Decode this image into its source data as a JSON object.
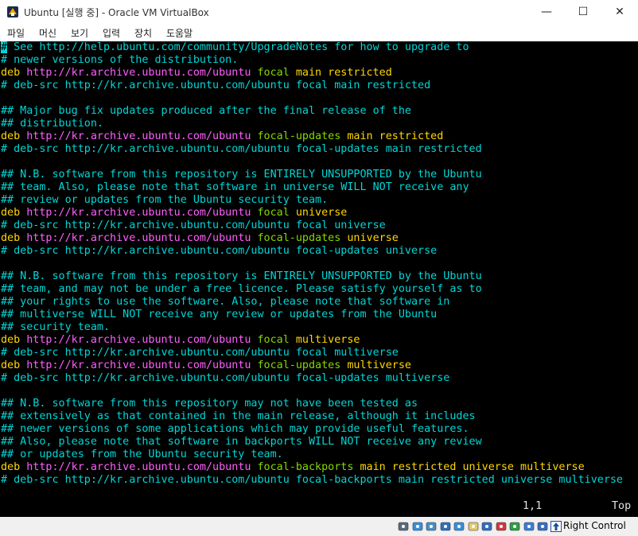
{
  "window": {
    "title": "Ubuntu [실행 중] - Oracle VM VirtualBox",
    "controls": {
      "minimize": "—",
      "maximize": "☐",
      "close": "✕"
    }
  },
  "menu": [
    "파일",
    "머신",
    "보기",
    "입력",
    "장치",
    "도움말"
  ],
  "terminal": {
    "lines": [
      [
        {
          "t": "#",
          "c": "cyan cursor"
        },
        {
          "t": " See http://help.ubuntu.com/community/UpgradeNotes for how to upgrade to",
          "c": "cyan"
        }
      ],
      [
        {
          "t": "# newer versions of the distribution.",
          "c": "cyan"
        }
      ],
      [
        {
          "t": "deb ",
          "c": "yellow"
        },
        {
          "t": "http://kr.archive.ubuntu.com/ubuntu ",
          "c": "magenta"
        },
        {
          "t": "focal ",
          "c": "green"
        },
        {
          "t": "main restricted",
          "c": "yellow"
        }
      ],
      [
        {
          "t": "# deb-src http://kr.archive.ubuntu.com/ubuntu focal main restricted",
          "c": "cyan"
        }
      ],
      [],
      [
        {
          "t": "## Major bug fix updates produced after the final release of the",
          "c": "cyan"
        }
      ],
      [
        {
          "t": "## distribution.",
          "c": "cyan"
        }
      ],
      [
        {
          "t": "deb ",
          "c": "yellow"
        },
        {
          "t": "http://kr.archive.ubuntu.com/ubuntu ",
          "c": "magenta"
        },
        {
          "t": "focal-updates ",
          "c": "green"
        },
        {
          "t": "main restricted",
          "c": "yellow"
        }
      ],
      [
        {
          "t": "# deb-src http://kr.archive.ubuntu.com/ubuntu focal-updates main restricted",
          "c": "cyan"
        }
      ],
      [],
      [
        {
          "t": "## N.B. software from this repository is ENTIRELY UNSUPPORTED by the Ubuntu",
          "c": "cyan"
        }
      ],
      [
        {
          "t": "## team. Also, please note that software in universe WILL NOT receive any",
          "c": "cyan"
        }
      ],
      [
        {
          "t": "## review or updates from the Ubuntu security team.",
          "c": "cyan"
        }
      ],
      [
        {
          "t": "deb ",
          "c": "yellow"
        },
        {
          "t": "http://kr.archive.ubuntu.com/ubuntu ",
          "c": "magenta"
        },
        {
          "t": "focal ",
          "c": "green"
        },
        {
          "t": "universe",
          "c": "yellow"
        }
      ],
      [
        {
          "t": "# deb-src http://kr.archive.ubuntu.com/ubuntu focal universe",
          "c": "cyan"
        }
      ],
      [
        {
          "t": "deb ",
          "c": "yellow"
        },
        {
          "t": "http://kr.archive.ubuntu.com/ubuntu ",
          "c": "magenta"
        },
        {
          "t": "focal-updates ",
          "c": "green"
        },
        {
          "t": "universe",
          "c": "yellow"
        }
      ],
      [
        {
          "t": "# deb-src http://kr.archive.ubuntu.com/ubuntu focal-updates universe",
          "c": "cyan"
        }
      ],
      [],
      [
        {
          "t": "## N.B. software from this repository is ENTIRELY UNSUPPORTED by the Ubuntu",
          "c": "cyan"
        }
      ],
      [
        {
          "t": "## team, and may not be under a free licence. Please satisfy yourself as to",
          "c": "cyan"
        }
      ],
      [
        {
          "t": "## your rights to use the software. Also, please note that software in",
          "c": "cyan"
        }
      ],
      [
        {
          "t": "## multiverse WILL NOT receive any review or updates from the Ubuntu",
          "c": "cyan"
        }
      ],
      [
        {
          "t": "## security team.",
          "c": "cyan"
        }
      ],
      [
        {
          "t": "deb ",
          "c": "yellow"
        },
        {
          "t": "http://kr.archive.ubuntu.com/ubuntu ",
          "c": "magenta"
        },
        {
          "t": "focal ",
          "c": "green"
        },
        {
          "t": "multiverse",
          "c": "yellow"
        }
      ],
      [
        {
          "t": "# deb-src http://kr.archive.ubuntu.com/ubuntu focal multiverse",
          "c": "cyan"
        }
      ],
      [
        {
          "t": "deb ",
          "c": "yellow"
        },
        {
          "t": "http://kr.archive.ubuntu.com/ubuntu ",
          "c": "magenta"
        },
        {
          "t": "focal-updates ",
          "c": "green"
        },
        {
          "t": "multiverse",
          "c": "yellow"
        }
      ],
      [
        {
          "t": "# deb-src http://kr.archive.ubuntu.com/ubuntu focal-updates multiverse",
          "c": "cyan"
        }
      ],
      [],
      [
        {
          "t": "## N.B. software from this repository may not have been tested as",
          "c": "cyan"
        }
      ],
      [
        {
          "t": "## extensively as that contained in the main release, although it includes",
          "c": "cyan"
        }
      ],
      [
        {
          "t": "## newer versions of some applications which may provide useful features.",
          "c": "cyan"
        }
      ],
      [
        {
          "t": "## Also, please note that software in backports WILL NOT receive any review",
          "c": "cyan"
        }
      ],
      [
        {
          "t": "## or updates from the Ubuntu security team.",
          "c": "cyan"
        }
      ],
      [
        {
          "t": "deb ",
          "c": "yellow"
        },
        {
          "t": "http://kr.archive.ubuntu.com/ubuntu ",
          "c": "magenta"
        },
        {
          "t": "focal-backports ",
          "c": "green"
        },
        {
          "t": "main restricted universe multiverse",
          "c": "yellow"
        }
      ],
      [
        {
          "t": "# deb-src http://kr.archive.ubuntu.com/ubuntu focal-backports main restricted universe multiverse",
          "c": "cyan"
        }
      ]
    ],
    "cursor_position": "1,1",
    "scroll_position": "Top"
  },
  "statusbar": {
    "icons": [
      "hard-disk-icon",
      "optical-disk-icon",
      "audio-icon",
      "network-icon",
      "usb-icon",
      "shared-folder-icon",
      "display-icon",
      "recording-icon",
      "cpu-icon",
      "mouse-integration-icon",
      "keyboard-icon"
    ],
    "host_key": "Right Control"
  },
  "colors": {
    "comment": "#00d7d7",
    "keyword": "#ffd700",
    "url": "#ff5fff",
    "suite": "#87d700",
    "terminal_bg": "#000000"
  }
}
